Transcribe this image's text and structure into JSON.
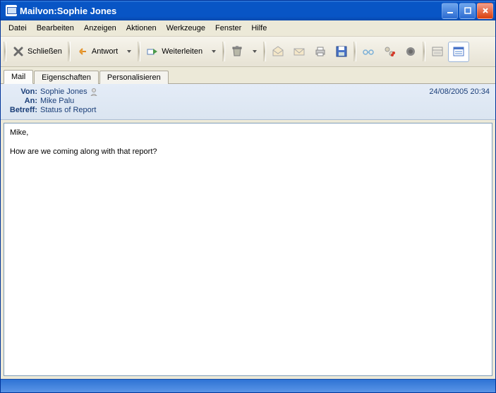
{
  "window": {
    "title": "Mailvon:Sophie Jones"
  },
  "menu": {
    "file": "Datei",
    "edit": "Bearbeiten",
    "view": "Anzeigen",
    "actions": "Aktionen",
    "tools": "Werkzeuge",
    "window": "Fenster",
    "help": "Hilfe"
  },
  "toolbar": {
    "close": "Schließen",
    "reply": "Antwort",
    "forward": "Weiterleiten"
  },
  "tabs": {
    "mail": "Mail",
    "properties": "Eigenschaften",
    "personalize": "Personalisieren"
  },
  "header": {
    "from_label": "Von:",
    "from_value": "Sophie Jones",
    "to_label": "An:",
    "to_value": "Mike Palu",
    "subject_label": "Betreff:",
    "subject_value": "Status of Report",
    "date": "24/08/2005 20:34"
  },
  "body": {
    "line1": "Mike,",
    "line2": "How are we coming along with that report?"
  }
}
